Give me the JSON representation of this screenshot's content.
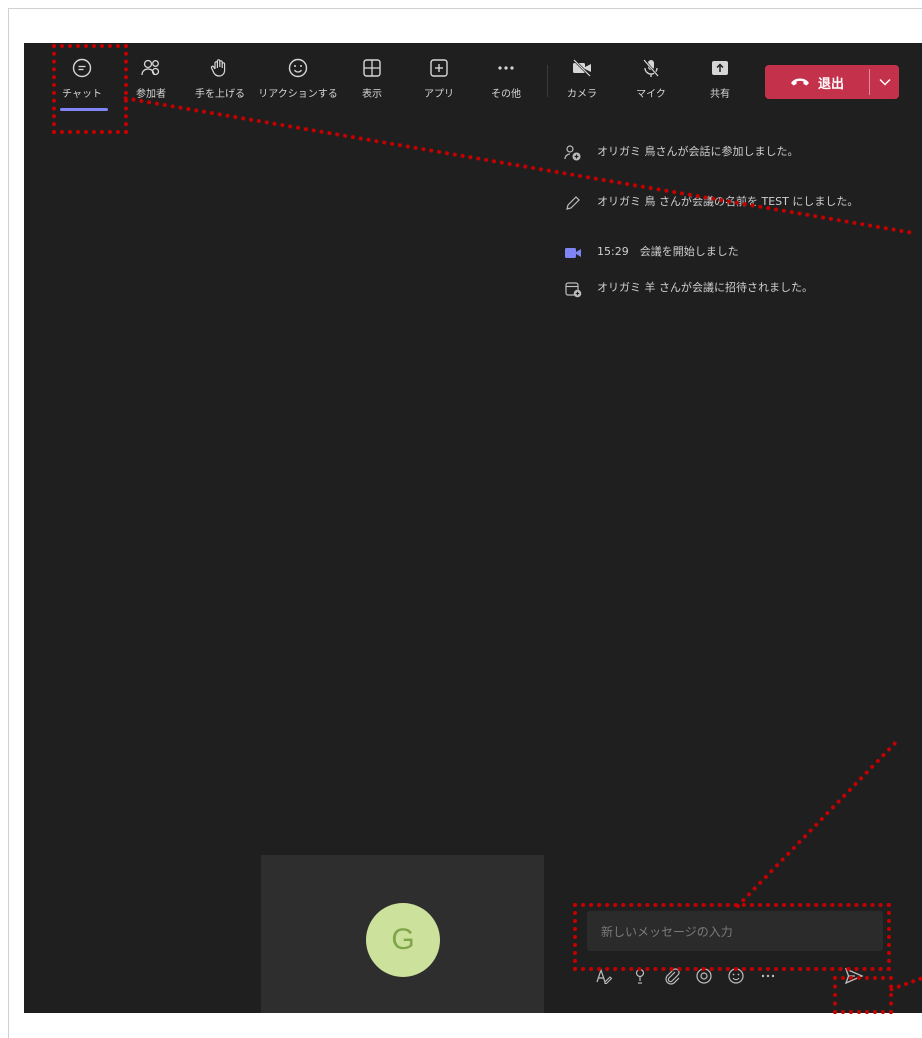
{
  "toolbar": {
    "chat": "チャット",
    "participants": "参加者",
    "raise_hand": "手を上げる",
    "reactions": "リアクションする",
    "view": "表示",
    "apps": "アプリ",
    "more": "その他",
    "camera": "カメラ",
    "mic": "マイク",
    "share": "共有",
    "leave": "退出"
  },
  "chat": {
    "events": [
      {
        "icon": "person-add-icon",
        "text": "オリガミ 鳥さんが会話に参加しました。"
      },
      {
        "icon": "pencil-icon",
        "text": "オリガミ 鳥 さんが会議の名前を TEST にしました。"
      },
      {
        "icon": "video-camera-icon",
        "text": "15:29　会議を開始しました"
      },
      {
        "icon": "calendar-invite-icon",
        "text": "オリガミ 羊 さんが会議に招待されました。"
      }
    ],
    "input_placeholder": "新しいメッセージの入力"
  },
  "video": {
    "avatar_initial": "G"
  },
  "colors": {
    "accent": "#7f85f5",
    "leave": "#c4314b",
    "annotation": "#c40000",
    "avatar_bg": "#cce29c"
  }
}
